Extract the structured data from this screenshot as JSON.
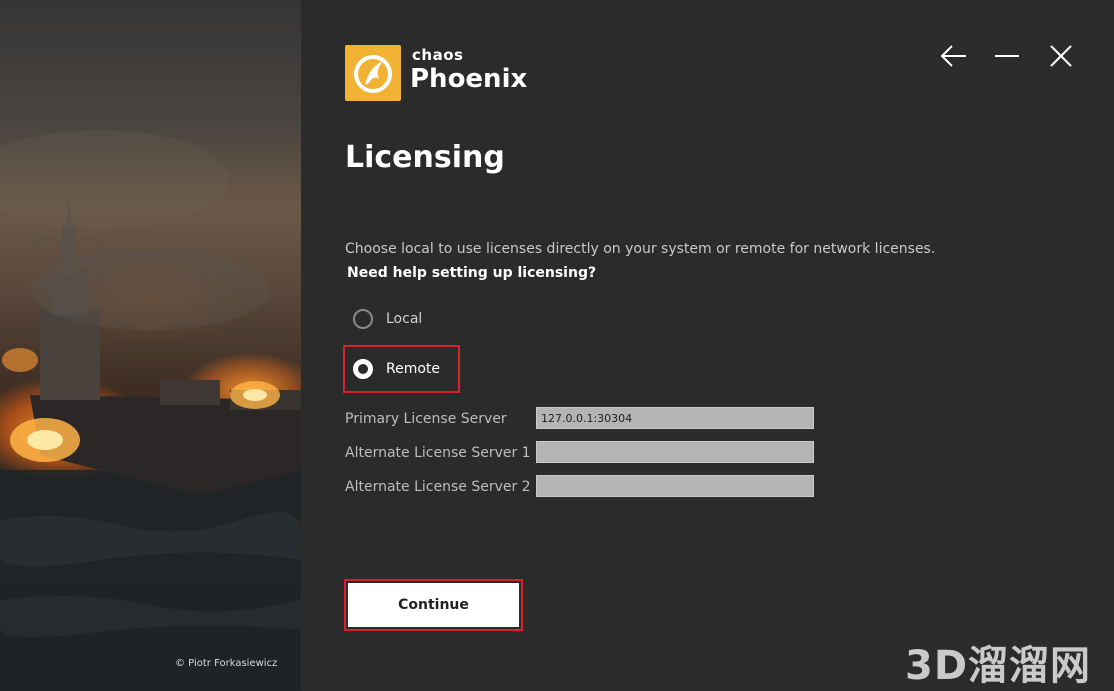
{
  "art": {
    "credit": "© Piotr Forkasiewicz"
  },
  "brand": {
    "company": "chaos",
    "product": "Phoenix"
  },
  "window_controls": {
    "back_icon": "arrow-left-icon",
    "minimize_icon": "minimize-icon",
    "close_icon": "close-icon"
  },
  "page": {
    "title": "Licensing",
    "description": "Choose local to use licenses directly on your system or remote for network licenses.",
    "help_link": "Need help setting up licensing?"
  },
  "options": {
    "local": {
      "label": "Local",
      "selected": false
    },
    "remote": {
      "label": "Remote",
      "selected": true
    }
  },
  "fields": {
    "primary": {
      "label": "Primary License Server",
      "value": "127.0.0.1:30304"
    },
    "alternate1": {
      "label": "Alternate License Server 1",
      "value": ""
    },
    "alternate2": {
      "label": "Alternate License Server 2",
      "value": ""
    }
  },
  "actions": {
    "continue_label": "Continue"
  },
  "watermark": "3D溜溜网",
  "colors": {
    "highlight": "#d6222a",
    "logo_bg": "#f2b335",
    "panel_bg": "#2b2b2b"
  }
}
